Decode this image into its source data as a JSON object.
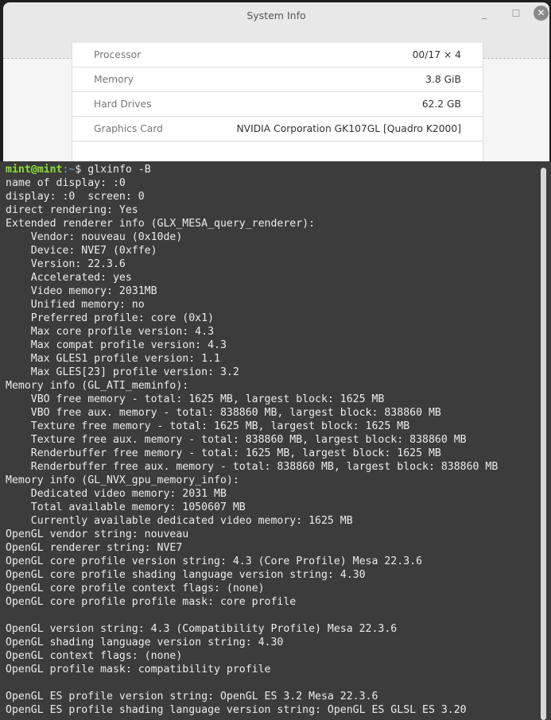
{
  "window": {
    "title": "System Info"
  },
  "system_info": {
    "rows": [
      {
        "label": "Processor",
        "value": "00/17 × 4"
      },
      {
        "label": "Memory",
        "value": "3.8 GiB"
      },
      {
        "label": "Hard Drives",
        "value": "62.2 GB"
      },
      {
        "label": "Graphics Card",
        "value": "NVIDIA Corporation GK107GL [Quadro K2000]"
      }
    ]
  },
  "terminal": {
    "prompt_user": "mint@mint",
    "prompt_path": ":~",
    "prompt_symbol": "$ ",
    "command": "glxinfo -B",
    "lines": [
      "name of display: :0",
      "display: :0  screen: 0",
      "direct rendering: Yes",
      "Extended renderer info (GLX_MESA_query_renderer):",
      "    Vendor: nouveau (0x10de)",
      "    Device: NVE7 (0xffe)",
      "    Version: 22.3.6",
      "    Accelerated: yes",
      "    Video memory: 2031MB",
      "    Unified memory: no",
      "    Preferred profile: core (0x1)",
      "    Max core profile version: 4.3",
      "    Max compat profile version: 4.3",
      "    Max GLES1 profile version: 1.1",
      "    Max GLES[23] profile version: 3.2",
      "Memory info (GL_ATI_meminfo):",
      "    VBO free memory - total: 1625 MB, largest block: 1625 MB",
      "    VBO free aux. memory - total: 838860 MB, largest block: 838860 MB",
      "    Texture free memory - total: 1625 MB, largest block: 1625 MB",
      "    Texture free aux. memory - total: 838860 MB, largest block: 838860 MB",
      "    Renderbuffer free memory - total: 1625 MB, largest block: 1625 MB",
      "    Renderbuffer free aux. memory - total: 838860 MB, largest block: 838860 MB",
      "Memory info (GL_NVX_gpu_memory_info):",
      "    Dedicated video memory: 2031 MB",
      "    Total available memory: 1050607 MB",
      "    Currently available dedicated video memory: 1625 MB",
      "OpenGL vendor string: nouveau",
      "OpenGL renderer string: NVE7",
      "OpenGL core profile version string: 4.3 (Core Profile) Mesa 22.3.6",
      "OpenGL core profile shading language version string: 4.30",
      "OpenGL core profile context flags: (none)",
      "OpenGL core profile profile mask: core profile",
      "",
      "OpenGL version string: 4.3 (Compatibility Profile) Mesa 22.3.6",
      "OpenGL shading language version string: 4.30",
      "OpenGL context flags: (none)",
      "OpenGL profile mask: compatibility profile",
      "",
      "OpenGL ES profile version string: OpenGL ES 3.2 Mesa 22.3.6",
      "OpenGL ES profile shading language version string: OpenGL ES GLSL ES 3.20"
    ]
  }
}
